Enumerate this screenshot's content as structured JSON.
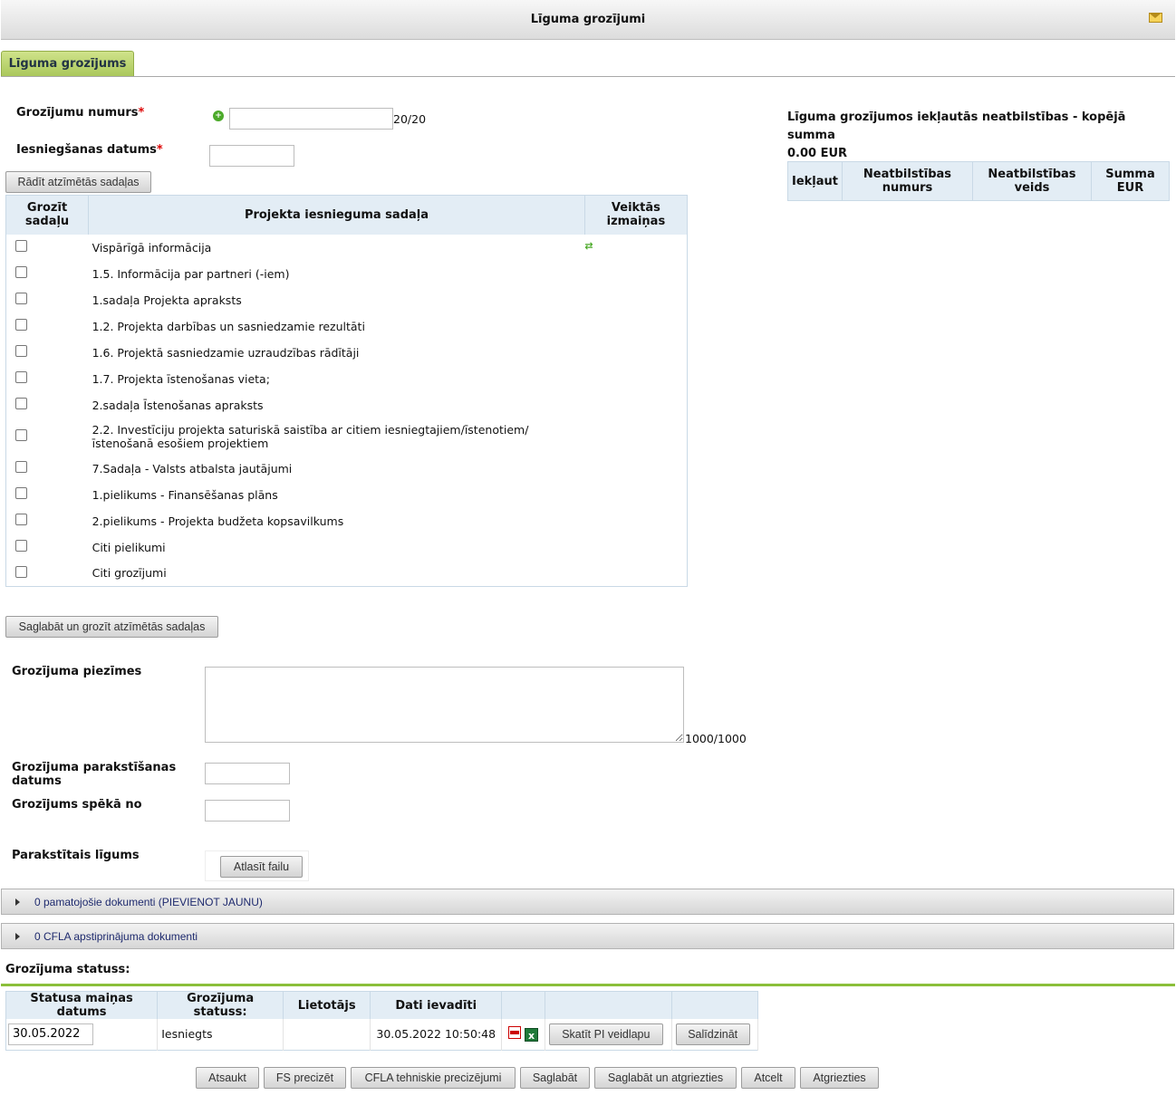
{
  "window": {
    "title": "Līguma grozījumi"
  },
  "tab": {
    "label": "Līguma grozījums"
  },
  "form": {
    "number_label": "Grozījumu numurs",
    "number_value": "",
    "number_counter": "20/20",
    "date_label": "Iesniegšanas datums",
    "date_value": "",
    "required_mark": "*",
    "show_sections_button": "Rādīt atzīmētās sadaļas"
  },
  "sections_table": {
    "headers": [
      "Grozīt sadaļu",
      "Projekta iesnieguma sadaļa",
      "Veiktās izmaiņas"
    ],
    "rows": [
      {
        "label": "Vispārīgā informācija",
        "changed": true
      },
      {
        "label": "1.5. Informācija par partneri (-iem)",
        "changed": false
      },
      {
        "label": "1.sadaļa Projekta apraksts",
        "changed": false
      },
      {
        "label": "1.2. Projekta darbības un sasniedzamie rezultāti",
        "changed": false
      },
      {
        "label": "1.6. Projektā sasniedzamie uzraudzības rādītāji",
        "changed": false
      },
      {
        "label": "1.7. Projekta īstenošanas vieta;",
        "changed": false
      },
      {
        "label": "2.sadaļa  Īstenošanas apraksts",
        "changed": false
      },
      {
        "label": "2.2. Investīciju projekta saturiskā saistība ar citiem iesniegtajiem/īstenotiem/īstenošanā esošiem projektiem",
        "changed": false
      },
      {
        "label": "7.Sadaļa - Valsts atbalsta jautājumi",
        "changed": false
      },
      {
        "label": "1.pielikums - Finansēšanas plāns",
        "changed": false
      },
      {
        "label": "2.pielikums - Projekta budžeta kopsavilkums",
        "changed": false
      },
      {
        "label": "Citi pielikumi",
        "changed": false
      },
      {
        "label": "Citi grozījumi",
        "changed": false
      }
    ]
  },
  "save_sections_button": "Saglabāt un grozīt atzīmētās sadaļas",
  "notes": {
    "label": "Grozījuma piezīmes",
    "value": "",
    "counter": "1000/1000"
  },
  "sign_date": {
    "label": "Grozījuma parakstīšanas datums",
    "value": ""
  },
  "effective_date": {
    "label": "Grozījums spēkā no",
    "value": ""
  },
  "signed_contract": {
    "label": "Parakstītais līgums",
    "button": "Atlasīt failu"
  },
  "right_panel": {
    "title": "Līguma grozījumos iekļautās neatbilstības - kopējā summa",
    "total": "0.00 EUR",
    "headers": [
      "Iekļaut",
      "Neatbilstības numurs",
      "Neatbilstības veids",
      "Summa EUR"
    ]
  },
  "accordions": [
    "0 pamatojošie dokumenti (PIEVIENOT JAUNU)",
    "0 CFLA apstiprinājuma dokumenti"
  ],
  "status": {
    "section_label": "Grozījuma statuss:",
    "headers": [
      "Statusa maiņas datums",
      "Grozījuma statuss:",
      "Lietotājs",
      "Dati ievadīti",
      "",
      "",
      ""
    ],
    "row": {
      "date": "30.05.2022",
      "status": "Iesniegts",
      "user": "",
      "entered": "30.05.2022 10:50:48",
      "view_button": "Skatīt PI veidlapu",
      "compare_button": "Salīdzināt"
    }
  },
  "footer_buttons": [
    "Atsaukt",
    "FS precizēt",
    "CFLA tehniskie precizējumi",
    "Saglabāt",
    "Saglabāt un atgriezties",
    "Atcelt",
    "Atgriezties"
  ],
  "colors": {
    "accent_green": "#8bbf3a",
    "tab_green": "#b5d06a",
    "header_blue": "#e3edf5"
  }
}
